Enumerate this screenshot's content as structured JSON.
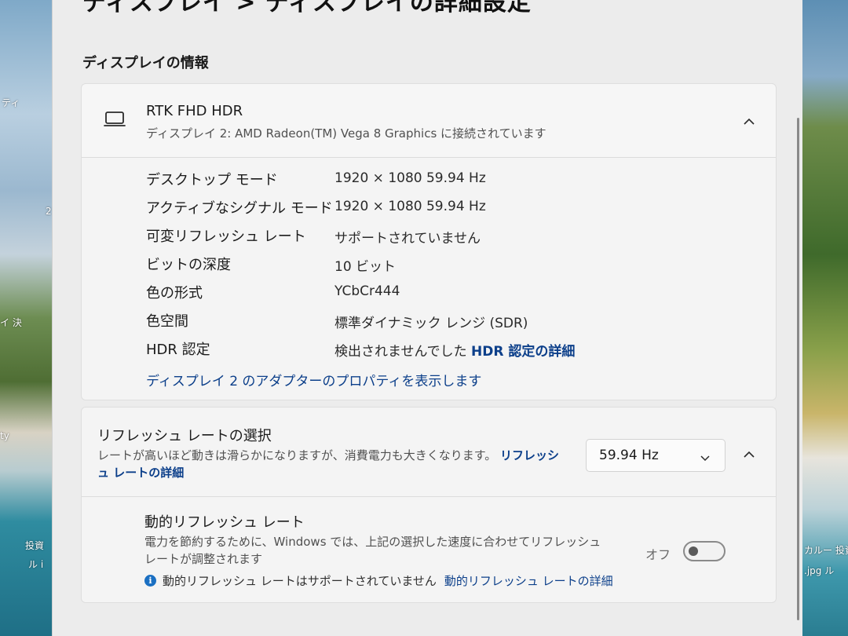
{
  "window": {
    "page_title": "ディスプレイ > ディスプレイの詳細設定"
  },
  "desktop": {
    "left_labels": [
      "ティ",
      "2",
      "イ 決",
      "ty",
      "投資",
      "ル i"
    ],
    "right_labels": [
      "カルー 投資",
      ".jpg ル"
    ]
  },
  "display_info": {
    "section_title": "ディスプレイの情報",
    "monitor_icon": "monitor-icon",
    "display_name": "RTK FHD HDR",
    "display_subtitle": "ディスプレイ 2: AMD Radeon(TM) Vega 8 Graphics に接続されています",
    "rows": [
      {
        "label": "デスクトップ モード",
        "value": "1920 × 1080 59.94 Hz"
      },
      {
        "label": "アクティブなシグナル モード",
        "value": "1920 × 1080 59.94 Hz"
      },
      {
        "label": "可変リフレッシュ レート",
        "value": "サポートされていません"
      },
      {
        "label": "ビットの深度",
        "value": "10 ビット"
      },
      {
        "label": "色の形式",
        "value": "YCbCr444"
      },
      {
        "label": "色空間",
        "value": "標準ダイナミック レンジ (SDR)"
      },
      {
        "label": "HDR 認定",
        "value": "検出されませんでした",
        "link": "HDR 認定の詳細"
      }
    ],
    "adapter_link": "ディスプレイ 2 のアダプターのプロパティを表示します"
  },
  "refresh_rate": {
    "title": "リフレッシュ レートの選択",
    "description": "レートが高いほど動きは滑らかになりますが、消費電力も大きくなります。",
    "link": "リフレッシュ レートの詳細",
    "selected_value": "59.94 Hz",
    "dynamic": {
      "title": "動的リフレッシュ レート",
      "description": "電力を節約するために、Windows では、上記の選択した速度に合わせてリフレッシュ レートが調整されます",
      "note": "動的リフレッシュ レートはサポートされていません",
      "note_link": "動的リフレッシュ レートの詳細",
      "toggle_label": "オフ",
      "toggle_on": false
    }
  },
  "colors": {
    "link": "#0c3f8a",
    "info_icon": "#1a6fc2",
    "window_bg": "#ececec",
    "card_bg": "#f4f4f4"
  }
}
